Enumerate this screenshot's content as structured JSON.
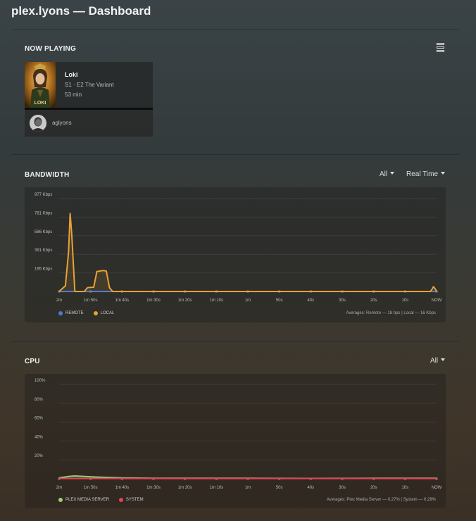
{
  "header": {
    "title": "plex.lyons — Dashboard"
  },
  "now_playing": {
    "section_title": "NOW PLAYING",
    "menu_icon": "list-view-icon",
    "session": {
      "title": "Loki",
      "episode": "S1 · E2 The Variant",
      "duration": "53 min",
      "user": "aglyons",
      "progress": 0
    }
  },
  "bandwidth": {
    "section_title": "BANDWIDTH",
    "filter": "All",
    "timespan": "Real Time",
    "legend": [
      {
        "label": "REMOTE",
        "color": "#4a7bd8"
      },
      {
        "label": "LOCAL",
        "color": "#e9a135"
      }
    ],
    "averages": "Averages: Remote — 18 bps | Local — 16 Kbps"
  },
  "cpu": {
    "section_title": "CPU",
    "filter": "All",
    "legend": [
      {
        "label": "PLEX MEDIA SERVER",
        "color": "#9ccf73"
      },
      {
        "label": "SYSTEM",
        "color": "#e0445a"
      }
    ],
    "averages": "Averages: Plex Media Server — 0.27% | System — 0.29%"
  },
  "chart_data": [
    {
      "type": "area",
      "x": [
        "2m",
        "1m 50s",
        "1m 40s",
        "1m 30s",
        "1m 20s",
        "1m 10s",
        "1m",
        "50s",
        "40s",
        "30s",
        "20s",
        "10s",
        "NOW"
      ],
      "y_ticks": [
        "195 Kbps",
        "391 Kbps",
        "586 Kbps",
        "781 Kbps",
        "977 Kbps"
      ],
      "ylim": [
        0,
        977
      ],
      "grid": true,
      "legend_position": "bottom-left",
      "series": [
        {
          "name": "REMOTE",
          "points": [
            [
              120,
              0
            ],
            [
              0,
              0
            ]
          ]
        },
        {
          "name": "LOCAL",
          "points": [
            [
              120,
              0
            ],
            [
              118,
              60
            ],
            [
              117,
              420
            ],
            [
              116.5,
              820
            ],
            [
              116,
              600
            ],
            [
              115,
              0
            ],
            [
              112,
              0
            ],
            [
              111,
              40
            ],
            [
              109,
              45
            ],
            [
              108,
              210
            ],
            [
              106,
              220
            ],
            [
              105,
              215
            ],
            [
              104,
              40
            ],
            [
              103,
              0
            ],
            [
              2,
              0
            ],
            [
              1.5,
              20
            ],
            [
              1,
              50
            ],
            [
              0.5,
              30
            ],
            [
              0,
              0
            ]
          ]
        }
      ]
    },
    {
      "type": "area",
      "x": [
        "2m",
        "1m 50s",
        "1m 40s",
        "1m 30s",
        "1m 20s",
        "1m 10s",
        "1m",
        "50s",
        "40s",
        "30s",
        "20s",
        "10s",
        "NOW"
      ],
      "y_ticks": [
        "20%",
        "40%",
        "60%",
        "80%",
        "100%"
      ],
      "ylim": [
        0,
        100
      ],
      "grid": true,
      "legend_position": "bottom-left",
      "series": [
        {
          "name": "PLEX MEDIA SERVER",
          "points": [
            [
              120,
              1.0
            ],
            [
              117,
              2.5
            ],
            [
              115,
              3.0
            ],
            [
              112,
              2.5
            ],
            [
              108,
              1.8
            ],
            [
              100,
              0.9
            ],
            [
              90,
              0.5
            ],
            [
              80,
              0.6
            ],
            [
              60,
              0.5
            ],
            [
              40,
              0.4
            ],
            [
              20,
              0.5
            ],
            [
              0,
              0.5
            ]
          ]
        },
        {
          "name": "SYSTEM",
          "points": [
            [
              120,
              0.3
            ],
            [
              0,
              0.3
            ]
          ]
        }
      ]
    }
  ]
}
